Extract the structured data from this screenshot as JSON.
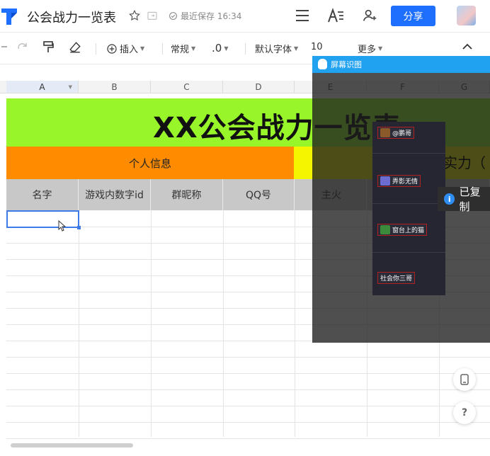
{
  "header": {
    "title": "公会战力一览表",
    "save_status": "最近保存 16:34",
    "share_label": "分享"
  },
  "toolbar": {
    "insert_label": "插入",
    "format_label": "常规",
    "decimal_label": ".0",
    "font_label": "默认字体",
    "font_size": "10",
    "more_label": "更多"
  },
  "sheet": {
    "columns": [
      "A",
      "B",
      "C",
      "D",
      "E",
      "F",
      "G"
    ],
    "title": "XX公会战力一览表",
    "section_personal": "个人信息",
    "section_strength": "实力（",
    "headers": [
      "名字",
      "游戏内数字id",
      "群昵称",
      "QQ号",
      "主火"
    ]
  },
  "overlay": {
    "title": "屏幕识图",
    "items": [
      "@鹏哥",
      "弄影无情",
      "窗台上的猫",
      "社会你三哥"
    ],
    "toast": "已复制"
  },
  "fab": {
    "help_label": "?"
  }
}
